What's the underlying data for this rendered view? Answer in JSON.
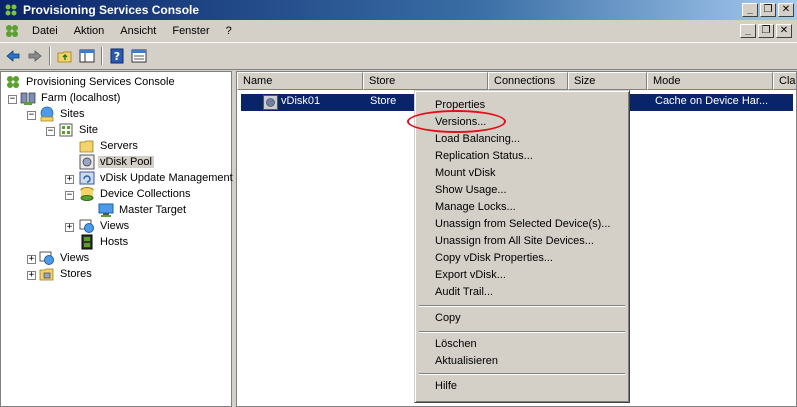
{
  "window": {
    "title": "Provisioning Services Console",
    "buttons": {
      "minimize": "_",
      "restore": "❐",
      "close": "✕"
    }
  },
  "menubar": {
    "items": [
      "Datei",
      "Aktion",
      "Ansicht",
      "Fenster",
      "?"
    ]
  },
  "toolbar": {
    "icons": [
      "back-icon",
      "forward-icon",
      "up-folder-icon",
      "show-hide-tree-icon",
      "help-icon",
      "properties-icon"
    ]
  },
  "tree": {
    "root": "Provisioning Services Console",
    "farm": "Farm (localhost)",
    "sites": "Sites",
    "site": "Site",
    "servers": "Servers",
    "vdisk_pool": "vDisk Pool",
    "vdisk_update": "vDisk Update Management",
    "device_collections": "Device Collections",
    "master_target": "Master Target",
    "site_views": "Views",
    "hosts": "Hosts",
    "views": "Views",
    "stores": "Stores",
    "expander_plus": "+",
    "expander_minus": "−"
  },
  "list": {
    "columns": [
      "Name",
      "Store",
      "Connections",
      "Size",
      "Mode",
      "Cla"
    ],
    "rows": [
      {
        "name": "vDisk01",
        "store": "Store",
        "connections": "",
        "size": "",
        "mode": "Cache on Device Har..."
      }
    ]
  },
  "context_menu": {
    "group1": [
      "Properties",
      "Versions...",
      "Load Balancing...",
      "Replication Status...",
      "Mount vDisk",
      "Show Usage...",
      "Manage Locks...",
      "Unassign from Selected Device(s)...",
      "Unassign from All Site Devices...",
      "Copy vDisk Properties...",
      "Export vDisk...",
      "Audit Trail..."
    ],
    "group2": [
      "Copy"
    ],
    "group3": [
      "Löschen",
      "Aktualisieren"
    ],
    "group4": [
      "Hilfe"
    ]
  },
  "colors": {
    "selection": "#0a246a",
    "annotation": "#e0101a",
    "chrome": "#d4d0c8"
  }
}
